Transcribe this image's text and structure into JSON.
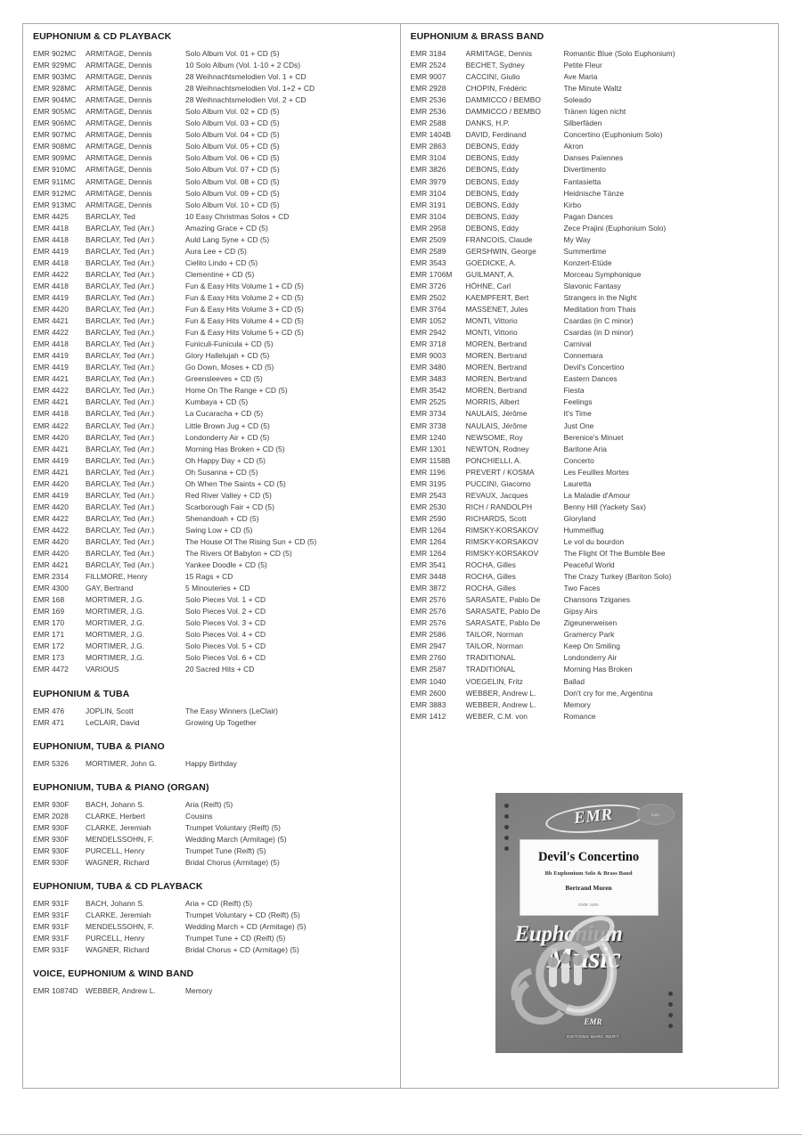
{
  "document": {
    "type": "music-catalog-page"
  },
  "left_column": {
    "sections": [
      {
        "title": "EUPHONIUM & CD PLAYBACK",
        "items": [
          {
            "ref": "EMR 902MC",
            "composer": "ARMITAGE, Dennis",
            "title": "Solo Album Vol. 01 + CD (5)"
          },
          {
            "ref": "EMR 929MC",
            "composer": "ARMITAGE, Dennis",
            "title": "10 Solo Album (Vol. 1-10 + 2 CDs)"
          },
          {
            "ref": "EMR 903MC",
            "composer": "ARMITAGE, Dennis",
            "title": "28 Weihnachtsmelodien Vol. 1 + CD"
          },
          {
            "ref": "EMR 928MC",
            "composer": "ARMITAGE, Dennis",
            "title": "28 Weihnachtsmelodien Vol. 1+2 + CD"
          },
          {
            "ref": "EMR 904MC",
            "composer": "ARMITAGE, Dennis",
            "title": "28 Weihnachtsmelodien Vol. 2 + CD"
          },
          {
            "ref": "EMR 905MC",
            "composer": "ARMITAGE, Dennis",
            "title": "Solo Album Vol. 02 + CD (5)"
          },
          {
            "ref": "EMR 906MC",
            "composer": "ARMITAGE, Dennis",
            "title": "Solo Album Vol. 03 + CD (5)"
          },
          {
            "ref": "EMR 907MC",
            "composer": "ARMITAGE, Dennis",
            "title": "Solo Album Vol. 04 + CD (5)"
          },
          {
            "ref": "EMR 908MC",
            "composer": "ARMITAGE, Dennis",
            "title": "Solo Album Vol. 05 + CD (5)"
          },
          {
            "ref": "EMR 909MC",
            "composer": "ARMITAGE, Dennis",
            "title": "Solo Album Vol. 06 + CD (5)"
          },
          {
            "ref": "EMR 910MC",
            "composer": "ARMITAGE, Dennis",
            "title": "Solo Album Vol. 07 + CD (5)"
          },
          {
            "ref": "EMR 911MC",
            "composer": "ARMITAGE, Dennis",
            "title": "Solo Album Vol. 08 + CD (5)"
          },
          {
            "ref": "EMR 912MC",
            "composer": "ARMITAGE, Dennis",
            "title": "Solo Album Vol. 09 + CD (5)"
          },
          {
            "ref": "EMR 913MC",
            "composer": "ARMITAGE, Dennis",
            "title": "Solo Album Vol. 10 + CD (5)"
          },
          {
            "ref": "EMR 4425",
            "composer": "BARCLAY, Ted",
            "title": "10 Easy Christmas Solos + CD"
          },
          {
            "ref": "EMR 4418",
            "composer": "BARCLAY, Ted (Arr.)",
            "title": "Amazing Grace + CD (5)"
          },
          {
            "ref": "EMR 4418",
            "composer": "BARCLAY, Ted (Arr.)",
            "title": "Auld Lang Syne + CD (5)"
          },
          {
            "ref": "EMR 4419",
            "composer": "BARCLAY, Ted (Arr.)",
            "title": "Aura Lee + CD (5)"
          },
          {
            "ref": "EMR 4418",
            "composer": "BARCLAY, Ted (Arr.)",
            "title": "Cielito Lindo + CD (5)"
          },
          {
            "ref": "EMR 4422",
            "composer": "BARCLAY, Ted (Arr.)",
            "title": "Clementine + CD (5)"
          },
          {
            "ref": "EMR 4418",
            "composer": "BARCLAY, Ted (Arr.)",
            "title": "Fun & Easy Hits Volume 1 + CD (5)"
          },
          {
            "ref": "EMR 4419",
            "composer": "BARCLAY, Ted (Arr.)",
            "title": "Fun & Easy Hits Volume 2 + CD (5)"
          },
          {
            "ref": "EMR 4420",
            "composer": "BARCLAY, Ted (Arr.)",
            "title": "Fun & Easy Hits Volume 3 + CD (5)"
          },
          {
            "ref": "EMR 4421",
            "composer": "BARCLAY, Ted (Arr.)",
            "title": "Fun & Easy Hits Volume 4 + CD (5)"
          },
          {
            "ref": "EMR 4422",
            "composer": "BARCLAY, Ted (Arr.)",
            "title": "Fun & Easy Hits Volume 5 + CD (5)"
          },
          {
            "ref": "EMR 4418",
            "composer": "BARCLAY, Ted (Arr.)",
            "title": "Funiculi-Funicula + CD (5)"
          },
          {
            "ref": "EMR 4419",
            "composer": "BARCLAY, Ted (Arr.)",
            "title": "Glory Hallelujah + CD (5)"
          },
          {
            "ref": "EMR 4419",
            "composer": "BARCLAY, Ted (Arr.)",
            "title": "Go Down, Moses + CD (5)"
          },
          {
            "ref": "EMR 4421",
            "composer": "BARCLAY, Ted (Arr.)",
            "title": "Greensleeves + CD (5)"
          },
          {
            "ref": "EMR 4422",
            "composer": "BARCLAY, Ted (Arr.)",
            "title": "Home On The Range + CD (5)"
          },
          {
            "ref": "EMR 4421",
            "composer": "BARCLAY, Ted (Arr.)",
            "title": "Kumbaya + CD (5)"
          },
          {
            "ref": "EMR 4418",
            "composer": "BARCLAY, Ted (Arr.)",
            "title": "La Cucaracha + CD (5)"
          },
          {
            "ref": "EMR 4422",
            "composer": "BARCLAY, Ted (Arr.)",
            "title": "Little Brown Jug + CD (5)"
          },
          {
            "ref": "EMR 4420",
            "composer": "BARCLAY, Ted (Arr.)",
            "title": "Londonderry Air + CD (5)"
          },
          {
            "ref": "EMR 4421",
            "composer": "BARCLAY, Ted (Arr.)",
            "title": "Morning Has Broken + CD (5)"
          },
          {
            "ref": "EMR 4419",
            "composer": "BARCLAY, Ted (Arr.)",
            "title": "Oh Happy Day + CD (5)"
          },
          {
            "ref": "EMR 4421",
            "composer": "BARCLAY, Ted (Arr.)",
            "title": "Oh Susanna + CD (5)"
          },
          {
            "ref": "EMR 4420",
            "composer": "BARCLAY, Ted (Arr.)",
            "title": "Oh When The Saints + CD (5)"
          },
          {
            "ref": "EMR 4419",
            "composer": "BARCLAY, Ted (Arr.)",
            "title": "Red River Valley + CD (5)"
          },
          {
            "ref": "EMR 4420",
            "composer": "BARCLAY, Ted (Arr.)",
            "title": "Scarborough Fair + CD (5)"
          },
          {
            "ref": "EMR 4422",
            "composer": "BARCLAY, Ted (Arr.)",
            "title": "Shenandoah + CD (5)"
          },
          {
            "ref": "EMR 4422",
            "composer": "BARCLAY, Ted (Arr.)",
            "title": "Swing Low + CD (5)"
          },
          {
            "ref": "EMR 4420",
            "composer": "BARCLAY, Ted (Arr.)",
            "title": "The House Of The Rising Sun + CD (5)"
          },
          {
            "ref": "EMR 4420",
            "composer": "BARCLAY, Ted (Arr.)",
            "title": "The Rivers Of Babylon + CD (5)"
          },
          {
            "ref": "EMR 4421",
            "composer": "BARCLAY, Ted (Arr.)",
            "title": "Yankee Doodle + CD (5)"
          },
          {
            "ref": "EMR 2314",
            "composer": "FILLMORE, Henry",
            "title": "15 Rags + CD"
          },
          {
            "ref": "EMR 4300",
            "composer": "GAY, Bertrand",
            "title": "5 Minouteries + CD"
          },
          {
            "ref": "EMR 168",
            "composer": "MORTIMER, J.G.",
            "title": "Solo Pieces Vol. 1 + CD"
          },
          {
            "ref": "EMR 169",
            "composer": "MORTIMER, J.G.",
            "title": "Solo Pieces Vol. 2 + CD"
          },
          {
            "ref": "EMR 170",
            "composer": "MORTIMER, J.G.",
            "title": "Solo Pieces Vol. 3 + CD"
          },
          {
            "ref": "EMR 171",
            "composer": "MORTIMER, J.G.",
            "title": "Solo Pieces Vol. 4 + CD"
          },
          {
            "ref": "EMR 172",
            "composer": "MORTIMER, J.G.",
            "title": "Solo Pieces Vol. 5 + CD"
          },
          {
            "ref": "EMR 173",
            "composer": "MORTIMER, J.G.",
            "title": "Solo Pieces Vol. 6 + CD"
          },
          {
            "ref": "EMR 4472",
            "composer": "VARIOUS",
            "title": "20 Sacred Hits + CD"
          }
        ]
      },
      {
        "title": "EUPHONIUM & TUBA",
        "items": [
          {
            "ref": "EMR 476",
            "composer": "JOPLIN, Scott",
            "title": "The Easy Winners (LeClair)"
          },
          {
            "ref": "EMR 471",
            "composer": "LeCLAIR, David",
            "title": "Growing Up Together"
          }
        ]
      },
      {
        "title": "EUPHONIUM, TUBA & PIANO",
        "items": [
          {
            "ref": "EMR 5326",
            "composer": "MORTIMER, John G.",
            "title": "Happy Birthday"
          }
        ]
      },
      {
        "title": "EUPHONIUM, TUBA & PIANO (ORGAN)",
        "items": [
          {
            "ref": "EMR 930F",
            "composer": "BACH, Johann S.",
            "title": "Aria (Reift) (5)"
          },
          {
            "ref": "EMR 2028",
            "composer": "CLARKE, Herbert",
            "title": "Cousins"
          },
          {
            "ref": "EMR 930F",
            "composer": "CLARKE, Jeremiah",
            "title": "Trumpet Voluntary (Reift) (5)"
          },
          {
            "ref": "EMR 930F",
            "composer": "MENDELSSOHN, F.",
            "title": "Wedding March (Armitage) (5)"
          },
          {
            "ref": "EMR 930F",
            "composer": "PURCELL, Henry",
            "title": "Trumpet Tune (Reift) (5)"
          },
          {
            "ref": "EMR 930F",
            "composer": "WAGNER, Richard",
            "title": "Bridal Chorus (Armitage) (5)"
          }
        ]
      },
      {
        "title": "EUPHONIUM, TUBA & CD PLAYBACK",
        "items": [
          {
            "ref": "EMR 931F",
            "composer": "BACH, Johann S.",
            "title": "Aria + CD (Reift) (5)"
          },
          {
            "ref": "EMR 931F",
            "composer": "CLARKE, Jeremiah",
            "title": "Trumpet Voluntary + CD (Reift) (5)"
          },
          {
            "ref": "EMR 931F",
            "composer": "MENDELSSOHN, F.",
            "title": "Wedding March + CD (Armitage) (5)"
          },
          {
            "ref": "EMR 931F",
            "composer": "PURCELL, Henry",
            "title": "Trumpet Tune + CD (Reift) (5)"
          },
          {
            "ref": "EMR 931F",
            "composer": "WAGNER, Richard",
            "title": "Bridal Chorus + CD (Armitage) (5)"
          }
        ]
      },
      {
        "title": "VOICE, EUPHONIUM & WIND BAND",
        "items": [
          {
            "ref": "EMR 10874D",
            "composer": "WEBBER, Andrew L.",
            "title": "Memory"
          }
        ]
      }
    ]
  },
  "right_column": {
    "sections": [
      {
        "title": "EUPHONIUM & BRASS BAND",
        "items": [
          {
            "ref": "EMR 3184",
            "composer": "ARMITAGE, Dennis",
            "title": "Romantic Blue (Solo Euphonium)"
          },
          {
            "ref": "EMR 2524",
            "composer": "BECHET, Sydney",
            "title": "Petite Fleur"
          },
          {
            "ref": "EMR 9007",
            "composer": "CACCINI, Giulio",
            "title": "Ave Maria"
          },
          {
            "ref": "EMR 2928",
            "composer": "CHOPIN, Frédéric",
            "title": "The Minute Waltz"
          },
          {
            "ref": "EMR 2536",
            "composer": "DAMMICCO / BEMBO",
            "title": "Soleado"
          },
          {
            "ref": "EMR 2536",
            "composer": "DAMMICCO / BEMBO",
            "title": "Tränen lügen nicht"
          },
          {
            "ref": "EMR 2588",
            "composer": "DANKS, H.P.",
            "title": "Silberfäden"
          },
          {
            "ref": "EMR 1404B",
            "composer": "DAVID, Ferdinand",
            "title": "Concertino (Euphonium Solo)"
          },
          {
            "ref": "EMR 2863",
            "composer": "DEBONS, Eddy",
            "title": "Akron"
          },
          {
            "ref": "EMR 3104",
            "composer": "DEBONS, Eddy",
            "title": "Danses Païennes"
          },
          {
            "ref": "EMR 3826",
            "composer": "DEBONS, Eddy",
            "title": "Divertimento"
          },
          {
            "ref": "EMR 3979",
            "composer": "DEBONS, Eddy",
            "title": "Fantasietta"
          },
          {
            "ref": "EMR 3104",
            "composer": "DEBONS, Eddy",
            "title": "Heidnische Tänze"
          },
          {
            "ref": "EMR 3191",
            "composer": "DEBONS, Eddy",
            "title": "Kirbo"
          },
          {
            "ref": "EMR 3104",
            "composer": "DEBONS, Eddy",
            "title": "Pagan Dances"
          },
          {
            "ref": "EMR 2958",
            "composer": "DEBONS, Eddy",
            "title": "Zece Prajini (Euphonium Solo)"
          },
          {
            "ref": "EMR 2509",
            "composer": "FRANCOIS, Claude",
            "title": "My Way"
          },
          {
            "ref": "EMR 2589",
            "composer": "GERSHWIN, George",
            "title": "Summertime"
          },
          {
            "ref": "EMR 3543",
            "composer": "GOEDICKE, A.",
            "title": "Konzert-Etüde"
          },
          {
            "ref": "EMR 1706M",
            "composer": "GUILMANT, A.",
            "title": "Morceau Symphonique"
          },
          {
            "ref": "EMR 3726",
            "composer": "HÖHNE, Carl",
            "title": "Slavonic Fantasy"
          },
          {
            "ref": "EMR 2502",
            "composer": "KAEMPFERT, Bert",
            "title": "Strangers in the Night"
          },
          {
            "ref": "EMR 3764",
            "composer": "MASSENET, Jules",
            "title": "Meditation from Thais"
          },
          {
            "ref": "EMR 1052",
            "composer": "MONTI, Vittorio",
            "title": "Csardas (in C minor)"
          },
          {
            "ref": "EMR 2942",
            "composer": "MONTI, Vittorio",
            "title": "Csardas (in D minor)"
          },
          {
            "ref": "EMR 3718",
            "composer": "MOREN, Bertrand",
            "title": "Carnival"
          },
          {
            "ref": "EMR 9003",
            "composer": "MOREN, Bertrand",
            "title": "Connemara"
          },
          {
            "ref": "EMR 3480",
            "composer": "MOREN, Bertrand",
            "title": "Devil's Concertino"
          },
          {
            "ref": "EMR 3483",
            "composer": "MOREN, Bertrand",
            "title": "Eastern Dances"
          },
          {
            "ref": "EMR 3542",
            "composer": "MOREN, Bertrand",
            "title": "Fiesta"
          },
          {
            "ref": "EMR 2525",
            "composer": "MORRIS, Albert",
            "title": "Feelings"
          },
          {
            "ref": "EMR 3734",
            "composer": "NAULAIS, Jérôme",
            "title": "It's Time"
          },
          {
            "ref": "EMR 3738",
            "composer": "NAULAIS, Jérôme",
            "title": "Just One"
          },
          {
            "ref": "EMR 1240",
            "composer": "NEWSOME, Roy",
            "title": "Berenice's Minuet"
          },
          {
            "ref": "EMR 1301",
            "composer": "NEWTON, Rodney",
            "title": "Baritone Aria"
          },
          {
            "ref": "EMR 1158B",
            "composer": "PONCHIELLI, A.",
            "title": "Concerto"
          },
          {
            "ref": "EMR 1196",
            "composer": "PREVERT / KOSMA",
            "title": "Les Feuilles Mortes"
          },
          {
            "ref": "EMR 3195",
            "composer": "PUCCINI, Giacomo",
            "title": "Lauretta"
          },
          {
            "ref": "EMR 2543",
            "composer": "REVAUX, Jacques",
            "title": "La Maladie d'Amour"
          },
          {
            "ref": "EMR 2530",
            "composer": "RICH / RANDOLPH",
            "title": "Benny Hill (Yackety Sax)"
          },
          {
            "ref": "EMR 2590",
            "composer": "RICHARDS, Scott",
            "title": "Gloryland"
          },
          {
            "ref": "EMR 1264",
            "composer": "RIMSKY-KORSAKOV",
            "title": "Hummelflug"
          },
          {
            "ref": "EMR 1264",
            "composer": "RIMSKY-KORSAKOV",
            "title": "Le vol du bourdon"
          },
          {
            "ref": "EMR 1264",
            "composer": "RIMSKY-KORSAKOV",
            "title": "The Flight Of The Bumble Bee"
          },
          {
            "ref": "EMR 3541",
            "composer": "ROCHA, Gilles",
            "title": "Peaceful World"
          },
          {
            "ref": "EMR 3448",
            "composer": "ROCHA, Gilles",
            "title": "The Crazy Turkey (Bariton Solo)"
          },
          {
            "ref": "EMR 3872",
            "composer": "ROCHA, Gilles",
            "title": "Two Faces"
          },
          {
            "ref": "EMR 2576",
            "composer": "SARASATE, Pablo De",
            "title": "Chansons Tziganes"
          },
          {
            "ref": "EMR 2576",
            "composer": "SARASATE, Pablo De",
            "title": "Gipsy Airs"
          },
          {
            "ref": "EMR 2576",
            "composer": "SARASATE, Pablo De",
            "title": "Zigeunerweisen"
          },
          {
            "ref": "EMR 2586",
            "composer": "TAILOR, Norman",
            "title": "Gramercy Park"
          },
          {
            "ref": "EMR 2947",
            "composer": "TAILOR, Norman",
            "title": "Keep On Smiling"
          },
          {
            "ref": "EMR 2760",
            "composer": "TRADITIONAL",
            "title": "Londonderry Air"
          },
          {
            "ref": "EMR 2587",
            "composer": "TRADITIONAL",
            "title": "Morning Has Broken"
          },
          {
            "ref": "EMR 1040",
            "composer": "VOEGELIN, Fritz",
            "title": "Ballad"
          },
          {
            "ref": "EMR 2600",
            "composer": "WEBBER, Andrew L.",
            "title": "Don't cry for me, Argentina"
          },
          {
            "ref": "EMR 3883",
            "composer": "WEBBER, Andrew L.",
            "title": "Memory"
          },
          {
            "ref": "EMR 1412",
            "composer": "WEBER, C.M. von",
            "title": "Romance"
          }
        ]
      }
    ]
  },
  "cover": {
    "publisher_logo": "EMR",
    "corner_stamp": "EMR",
    "title": "Devil's Concertino",
    "subtitle": "Bb Euphonium Solo & Brass Band",
    "composer": "Bertrand Moren",
    "code": "EMR 3480",
    "series_line1": "Euphonium",
    "series_line2": "Music",
    "footer_logo": "EMR",
    "footer_publisher": "EDITIONS MARC REIFT"
  }
}
